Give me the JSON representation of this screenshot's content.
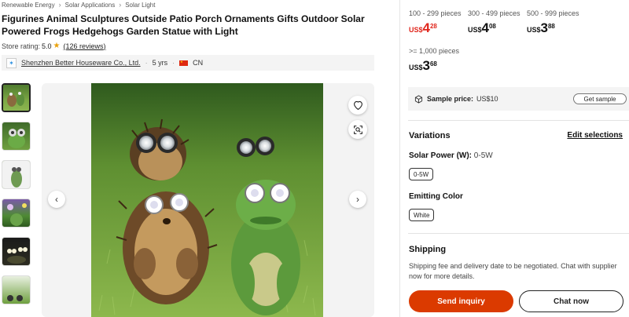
{
  "breadcrumb": [
    "Renewable Energy",
    "Solar Applications",
    "Solar Light"
  ],
  "product": {
    "title": "Figurines Animal Sculptures Outside Patio Porch Ornaments Gifts Outdoor Solar Powered Frogs Hedgehogs Garden Statue with Light",
    "rating_label": "Store rating:",
    "rating_value": "5.0",
    "reviews": "(126 reviews)"
  },
  "supplier": {
    "name": "Shenzhen Better Houseware Co., Ltd.",
    "years": "5 yrs",
    "country": "CN"
  },
  "price_tiers": [
    {
      "range": "100 - 299 pieces",
      "currency": "US$",
      "int": "4",
      "dec": "28",
      "color": "#e0261c"
    },
    {
      "range": "300 - 499 pieces",
      "currency": "US$",
      "int": "4",
      "dec": "08",
      "color": "#111111"
    },
    {
      "range": "500 - 999 pieces",
      "currency": "US$",
      "int": "3",
      "dec": "88",
      "color": "#111111"
    },
    {
      "range": ">= 1,000 pieces",
      "currency": "US$",
      "int": "3",
      "dec": "68",
      "color": "#111111"
    }
  ],
  "sample": {
    "label": "Sample price:",
    "value": "US$10",
    "button": "Get sample"
  },
  "variations": {
    "title": "Variations",
    "edit": "Edit selections",
    "solar_power_label": "Solar Power (W):",
    "solar_power_value": "0-5W",
    "solar_power_option": "0-5W",
    "emitting_color_label": "Emitting Color",
    "emitting_color_option": "White"
  },
  "shipping": {
    "title": "Shipping",
    "text": "Shipping fee and delivery date to be negotiated. Chat with supplier now for more details."
  },
  "actions": {
    "inquiry": "Send inquiry",
    "chat": "Chat now"
  },
  "colors": {
    "accent": "#db3a00",
    "price_red": "#e0261c",
    "star": "#e9a10b"
  }
}
